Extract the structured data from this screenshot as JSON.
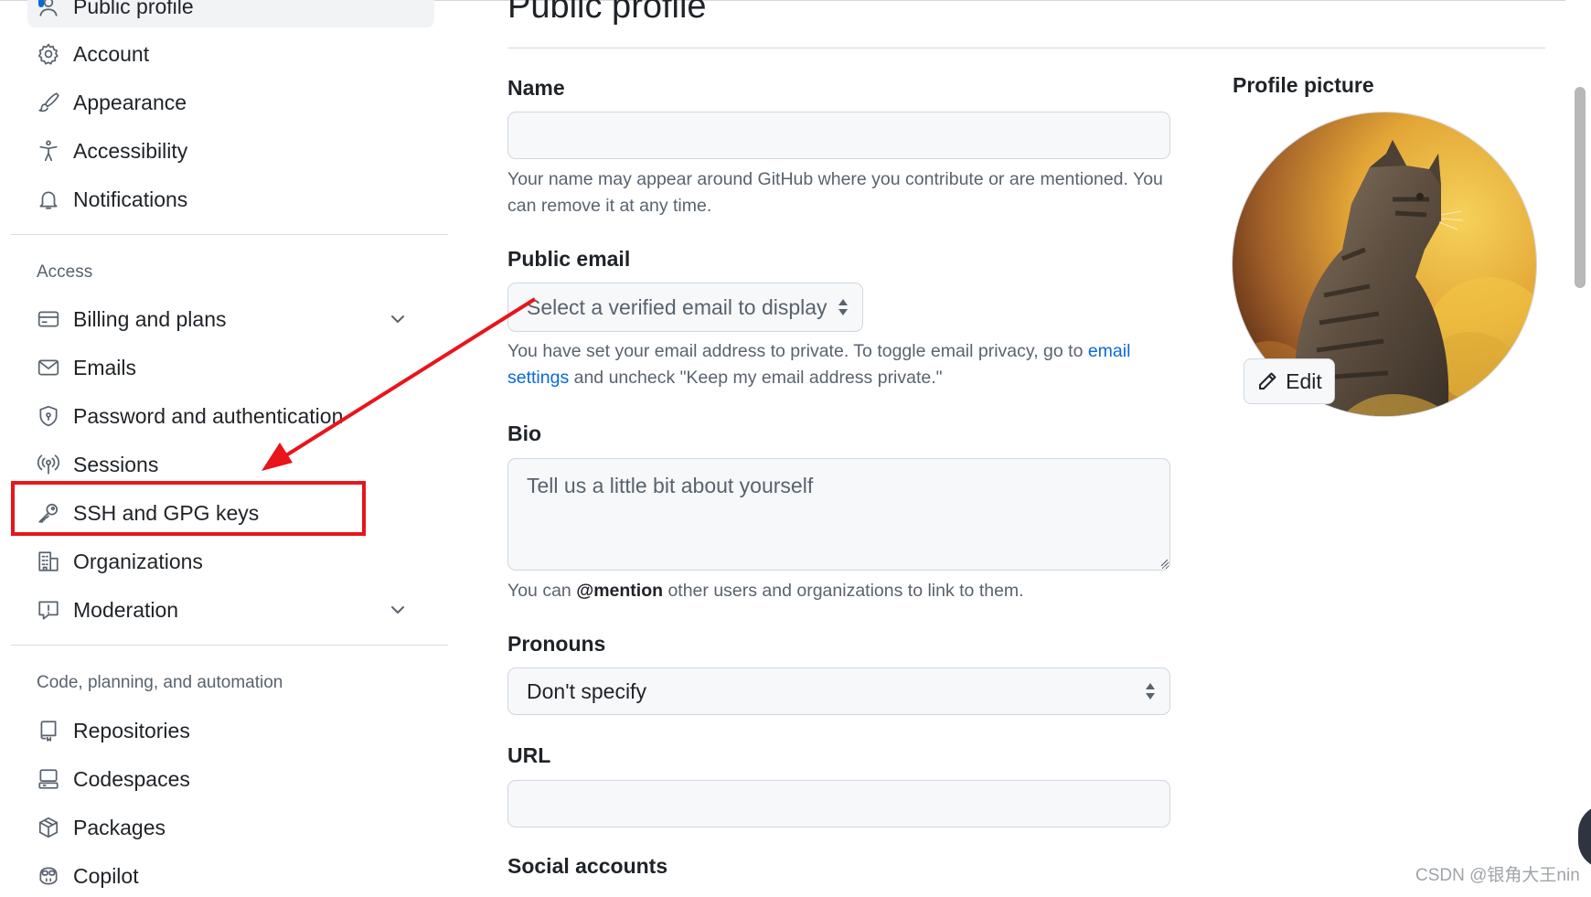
{
  "sidebar": {
    "items_top": [
      {
        "label": "Public profile",
        "icon": "person-icon"
      },
      {
        "label": "Account",
        "icon": "gear-icon"
      },
      {
        "label": "Appearance",
        "icon": "paintbrush-icon"
      },
      {
        "label": "Accessibility",
        "icon": "accessibility-icon"
      },
      {
        "label": "Notifications",
        "icon": "bell-icon"
      }
    ],
    "access_header": "Access",
    "access_items": [
      {
        "label": "Billing and plans",
        "icon": "credit-card-icon",
        "expandable": true
      },
      {
        "label": "Emails",
        "icon": "mail-icon"
      },
      {
        "label": "Password and authentication",
        "icon": "shield-lock-icon"
      },
      {
        "label": "Sessions",
        "icon": "broadcast-icon"
      },
      {
        "label": "SSH and GPG keys",
        "icon": "key-icon",
        "highlighted": true
      },
      {
        "label": "Organizations",
        "icon": "organization-icon"
      },
      {
        "label": "Moderation",
        "icon": "report-icon",
        "expandable": true
      }
    ],
    "code_header": "Code, planning, and automation",
    "code_items": [
      {
        "label": "Repositories",
        "icon": "repo-icon"
      },
      {
        "label": "Codespaces",
        "icon": "codespaces-icon"
      },
      {
        "label": "Packages",
        "icon": "package-icon"
      },
      {
        "label": "Copilot",
        "icon": "copilot-icon"
      }
    ]
  },
  "main": {
    "title": "Public profile",
    "name": {
      "label": "Name",
      "value": "",
      "note": "Your name may appear around GitHub where you contribute or are mentioned. You can remove it at any time."
    },
    "public_email": {
      "label": "Public email",
      "selected": "Select a verified email to display",
      "note_before": "You have set your email address to private. To toggle email privacy, go to ",
      "note_link": "email settings",
      "note_after": " and uncheck \"Keep my email address private.\""
    },
    "bio": {
      "label": "Bio",
      "placeholder": "Tell us a little bit about yourself",
      "note_before": "You can ",
      "note_mention": "@mention",
      "note_after": " other users and organizations to link to them."
    },
    "pronouns": {
      "label": "Pronouns",
      "selected": "Don't specify"
    },
    "url": {
      "label": "URL",
      "value": ""
    },
    "social": {
      "label": "Social accounts"
    },
    "profile_picture": {
      "label": "Profile picture",
      "edit_label": "Edit",
      "subject": "tabby cat sitting in yellow flowers"
    }
  },
  "annotation": {
    "highlight_color": "#e8151b"
  },
  "watermark": "CSDN @银角大王nin",
  "colors": {
    "accent": "#0969da",
    "text": "#1f2328",
    "muted": "#59636e",
    "input_bg": "#f6f8fa",
    "border": "#d0d7de",
    "annotation": "#e8151b"
  }
}
